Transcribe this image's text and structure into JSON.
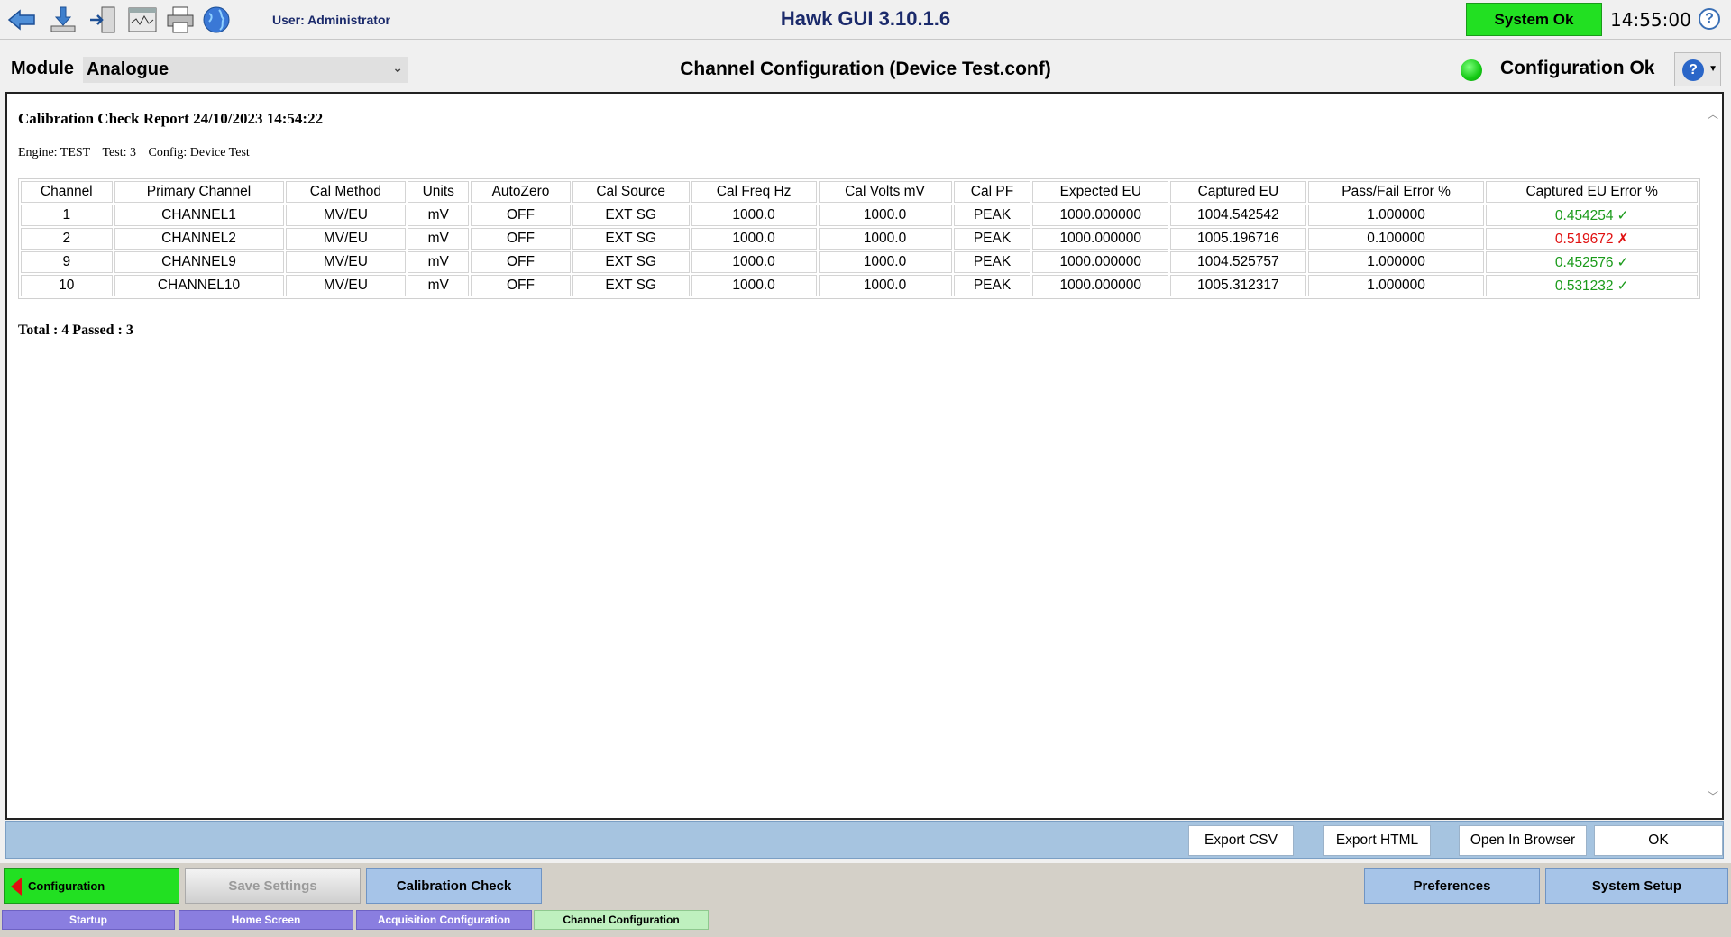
{
  "topbar": {
    "user_label": "User: Administrator",
    "app_title": "Hawk GUI 3.10.1.6",
    "system_status": "System Ok",
    "system_status_color": "#22e022",
    "clock": "14:55:00",
    "help_glyph": "?",
    "icons": [
      "back-arrow-icon",
      "download-icon",
      "exit-door-icon",
      "signal-monitor-icon",
      "printer-icon",
      "globe-icon"
    ]
  },
  "module_row": {
    "label": "Module",
    "selected_module": "Analogue",
    "title": "Channel Configuration (Device Test.conf)",
    "config_status": "Configuration Ok",
    "status_color": "#14c914",
    "help_glyph": "?"
  },
  "report": {
    "title": "Calibration Check Report 24/10/2023 14:54:22",
    "engine": "Engine: TEST",
    "test": "Test: 3",
    "config": "Config: Device Test",
    "columns": [
      "Channel",
      "Primary Channel",
      "Cal Method",
      "Units",
      "AutoZero",
      "Cal Source",
      "Cal Freq Hz",
      "Cal Volts mV",
      "Cal PF",
      "Expected EU",
      "Captured EU",
      "Pass/Fail Error %",
      "Captured EU Error %"
    ],
    "rows": [
      {
        "cells": [
          "1",
          "CHANNEL1",
          "MV/EU",
          "mV",
          "OFF",
          "EXT SG",
          "1000.0",
          "1000.0",
          "PEAK",
          "1000.000000",
          "1004.542542",
          "1.000000"
        ],
        "error": "0.454254",
        "mark": "✓",
        "passed": true
      },
      {
        "cells": [
          "2",
          "CHANNEL2",
          "MV/EU",
          "mV",
          "OFF",
          "EXT SG",
          "1000.0",
          "1000.0",
          "PEAK",
          "1000.000000",
          "1005.196716",
          "0.100000"
        ],
        "error": "0.519672",
        "mark": "✗",
        "passed": false
      },
      {
        "cells": [
          "9",
          "CHANNEL9",
          "MV/EU",
          "mV",
          "OFF",
          "EXT SG",
          "1000.0",
          "1000.0",
          "PEAK",
          "1000.000000",
          "1004.525757",
          "1.000000"
        ],
        "error": "0.452576",
        "mark": "✓",
        "passed": true
      },
      {
        "cells": [
          "10",
          "CHANNEL10",
          "MV/EU",
          "mV",
          "OFF",
          "EXT SG",
          "1000.0",
          "1000.0",
          "PEAK",
          "1000.000000",
          "1005.312317",
          "1.000000"
        ],
        "error": "0.531232",
        "mark": "✓",
        "passed": true
      }
    ],
    "total": "Total : 4 Passed : 3",
    "pass_color": "#1a9a1a",
    "fail_color": "#e01010"
  },
  "actions": {
    "export_csv": "Export CSV",
    "export_html": "Export HTML",
    "open_browser": "Open In Browser",
    "ok": "OK"
  },
  "nav": {
    "configuration": "Configuration",
    "save_settings": "Save Settings",
    "calibration_check": "Calibration Check",
    "preferences": "Preferences",
    "system_setup": "System Setup"
  },
  "tabs": [
    "Startup",
    "Home Screen",
    "Acquisition Configuration",
    "Channel Configuration"
  ],
  "active_tab": "Channel Configuration"
}
